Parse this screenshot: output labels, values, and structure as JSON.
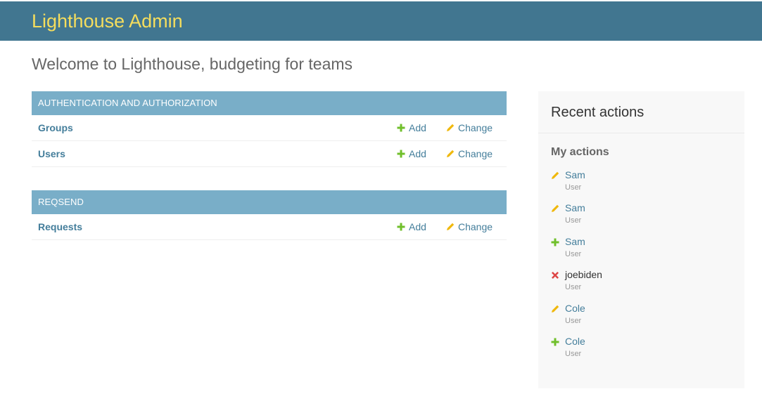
{
  "header": {
    "site_name": "Lighthouse Admin"
  },
  "page": {
    "title": "Welcome to Lighthouse, budgeting for teams"
  },
  "apps": [
    {
      "caption": "AUTHENTICATION AND AUTHORIZATION",
      "models": [
        {
          "name": "Groups",
          "add_label": "Add",
          "change_label": "Change"
        },
        {
          "name": "Users",
          "add_label": "Add",
          "change_label": "Change"
        }
      ]
    },
    {
      "caption": "REQSEND",
      "models": [
        {
          "name": "Requests",
          "add_label": "Add",
          "change_label": "Change"
        }
      ]
    }
  ],
  "recent_actions": {
    "title": "Recent actions",
    "subtitle": "My actions",
    "items": [
      {
        "icon": "pencil-icon",
        "name": "Sam",
        "type": "User"
      },
      {
        "icon": "pencil-icon",
        "name": "Sam",
        "type": "User"
      },
      {
        "icon": "plus-icon",
        "name": "Sam",
        "type": "User"
      },
      {
        "icon": "delete-icon",
        "name": "joebiden",
        "type": "User"
      },
      {
        "icon": "pencil-icon",
        "name": "Cole",
        "type": "User"
      },
      {
        "icon": "plus-icon",
        "name": "Cole",
        "type": "User"
      }
    ]
  },
  "colors": {
    "header_bg": "#417690",
    "site_name": "#f5dd5d",
    "caption_bg": "#79aec8",
    "link": "#447e9b",
    "add_green": "#70bf2b",
    "change_yellow": "#efb80b",
    "delete_red": "#dd4646"
  }
}
